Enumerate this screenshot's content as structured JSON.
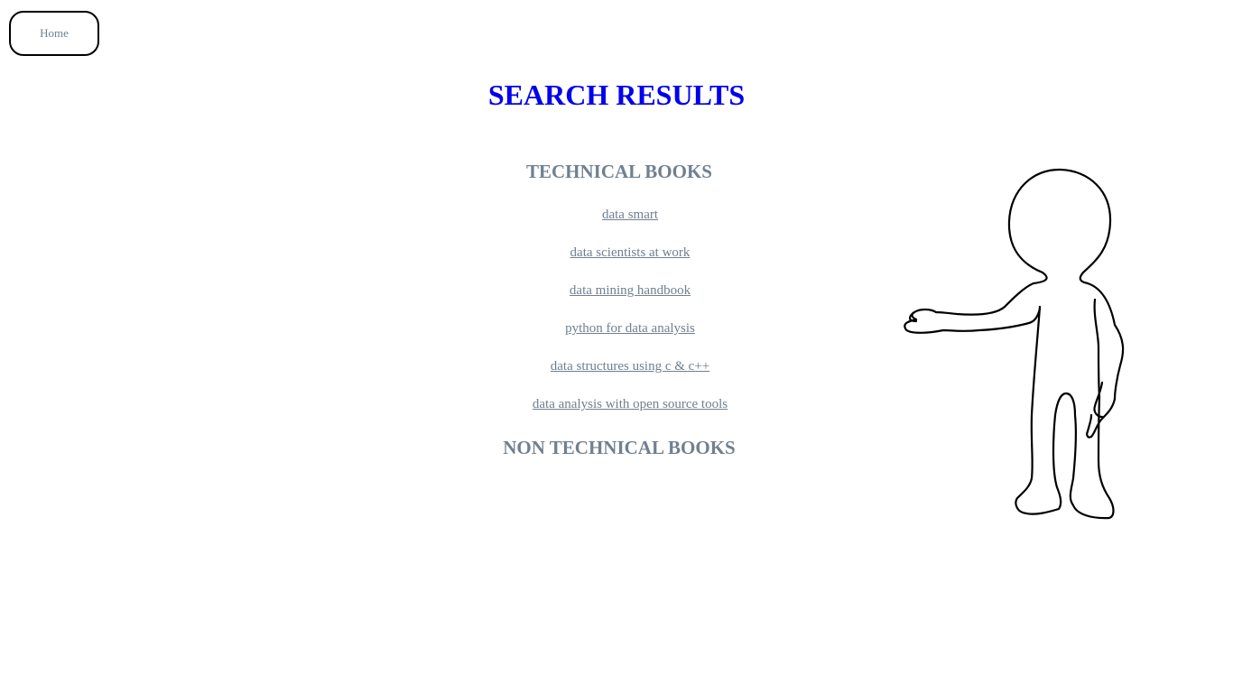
{
  "nav": {
    "home_label": "Home"
  },
  "page": {
    "title": "SEARCH RESULTS"
  },
  "sections": {
    "technical": {
      "heading": "TECHNICAL BOOKS",
      "books": [
        "data smart",
        "data scientists at work",
        "data mining handbook",
        "python for data analysis",
        "data structures using c & c++",
        "data analysis with open source tools"
      ]
    },
    "non_technical": {
      "heading": "NON TECHNICAL BOOKS"
    }
  },
  "colors": {
    "title": "#0000ee",
    "text": "#708090",
    "border": "#000000"
  },
  "icons": {
    "illustration": "presenting-stick-figure-icon"
  }
}
